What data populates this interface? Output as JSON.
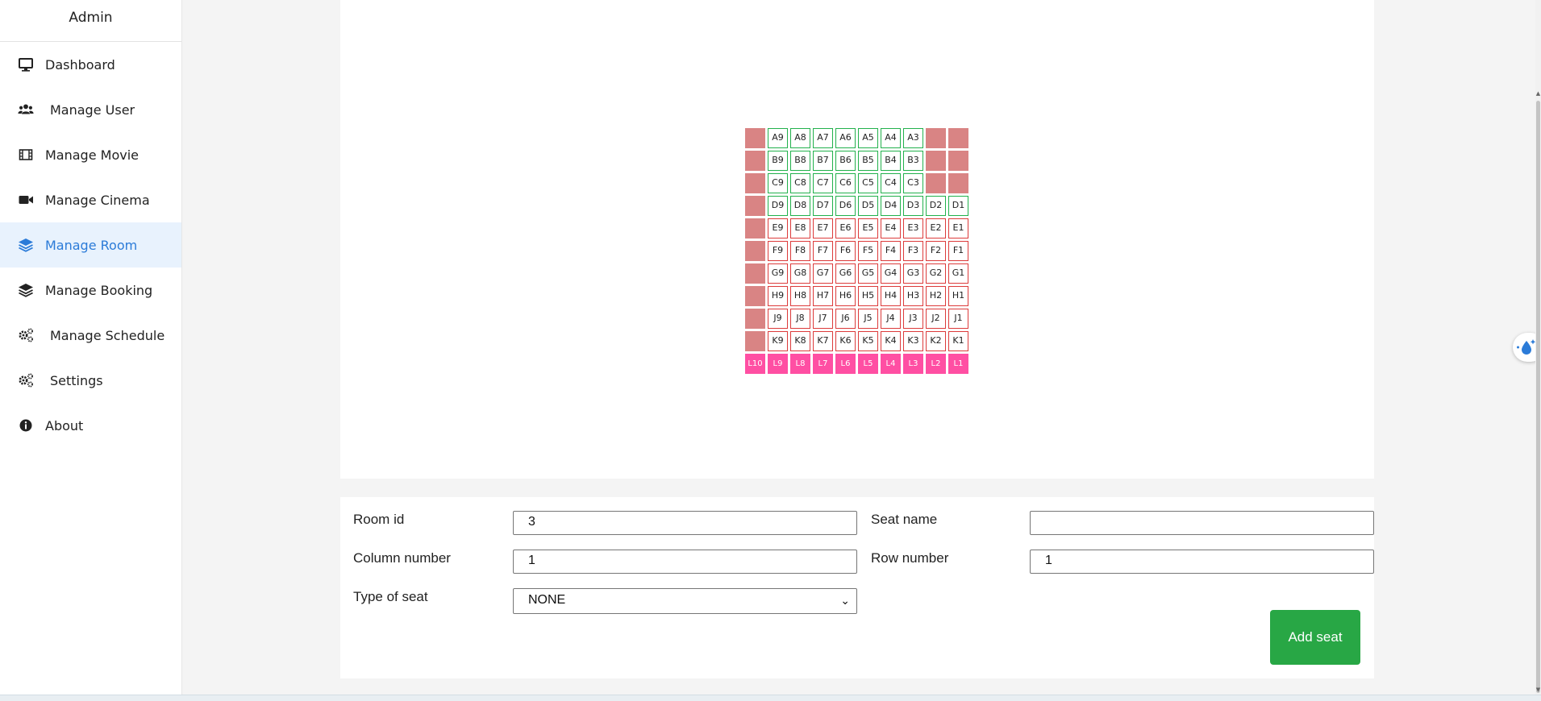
{
  "sidebar": {
    "brand": "Admin",
    "items": [
      {
        "label": "Dashboard",
        "icon": "desktop-icon"
      },
      {
        "label": "Manage User",
        "icon": "users-icon"
      },
      {
        "label": "Manage Movie",
        "icon": "film-icon"
      },
      {
        "label": "Manage Cinema",
        "icon": "video-camera-icon"
      },
      {
        "label": "Manage Room",
        "icon": "layers-icon",
        "active": true
      },
      {
        "label": "Manage Booking",
        "icon": "layers-icon"
      },
      {
        "label": "Manage Schedule",
        "icon": "gears-icon"
      },
      {
        "label": "Settings",
        "icon": "gears-icon"
      },
      {
        "label": "About",
        "icon": "info-circle-icon"
      }
    ]
  },
  "seat_map": {
    "rows": [
      [
        "",
        "A9",
        "A8",
        "A7",
        "A6",
        "A5",
        "A4",
        "A3",
        "",
        ""
      ],
      [
        "",
        "B9",
        "B8",
        "B7",
        "B6",
        "B5",
        "B4",
        "B3",
        "",
        ""
      ],
      [
        "",
        "C9",
        "C8",
        "C7",
        "C6",
        "C5",
        "C4",
        "C3",
        "",
        ""
      ],
      [
        "",
        "D9",
        "D8",
        "D7",
        "D6",
        "D5",
        "D4",
        "D3",
        "D2",
        "D1"
      ],
      [
        "",
        "E9",
        "E8",
        "E7",
        "E6",
        "E5",
        "E4",
        "E3",
        "E2",
        "E1"
      ],
      [
        "",
        "F9",
        "F8",
        "F7",
        "F6",
        "F5",
        "F4",
        "F3",
        "F2",
        "F1"
      ],
      [
        "",
        "G9",
        "G8",
        "G7",
        "G6",
        "G5",
        "G4",
        "G3",
        "G2",
        "G1"
      ],
      [
        "",
        "H9",
        "H8",
        "H7",
        "H6",
        "H5",
        "H4",
        "H3",
        "H2",
        "H1"
      ],
      [
        "",
        "J9",
        "J8",
        "J7",
        "J6",
        "J5",
        "J4",
        "J3",
        "J2",
        "J1"
      ],
      [
        "",
        "K9",
        "K8",
        "K7",
        "K6",
        "K5",
        "K4",
        "K3",
        "K2",
        "K1"
      ],
      [
        "L10",
        "L9",
        "L8",
        "L7",
        "L6",
        "L5",
        "L4",
        "L3",
        "L2",
        "L1"
      ]
    ],
    "types": [
      [
        "blocked",
        "vip",
        "vip",
        "vip",
        "vip",
        "vip",
        "vip",
        "vip",
        "blocked",
        "blocked"
      ],
      [
        "blocked",
        "vip",
        "vip",
        "vip",
        "vip",
        "vip",
        "vip",
        "vip",
        "blocked",
        "blocked"
      ],
      [
        "blocked",
        "vip",
        "vip",
        "vip",
        "vip",
        "vip",
        "vip",
        "vip",
        "blocked",
        "blocked"
      ],
      [
        "blocked",
        "vip",
        "vip",
        "vip",
        "vip",
        "vip",
        "vip",
        "vip",
        "vip",
        "vip"
      ],
      [
        "blocked",
        "normal",
        "normal",
        "normal",
        "normal",
        "normal",
        "normal",
        "normal",
        "normal",
        "normal"
      ],
      [
        "blocked",
        "normal",
        "normal",
        "normal",
        "normal",
        "normal",
        "normal",
        "normal",
        "normal",
        "normal"
      ],
      [
        "blocked",
        "normal",
        "normal",
        "normal",
        "normal",
        "normal",
        "normal",
        "normal",
        "normal",
        "normal"
      ],
      [
        "blocked",
        "normal",
        "normal",
        "normal",
        "normal",
        "normal",
        "normal",
        "normal",
        "normal",
        "normal"
      ],
      [
        "blocked",
        "normal",
        "normal",
        "normal",
        "normal",
        "normal",
        "normal",
        "normal",
        "normal",
        "normal"
      ],
      [
        "blocked",
        "normal",
        "normal",
        "normal",
        "normal",
        "normal",
        "normal",
        "normal",
        "normal",
        "normal"
      ],
      [
        "couple",
        "couple",
        "couple",
        "couple",
        "couple",
        "couple",
        "couple",
        "couple",
        "couple",
        "couple"
      ]
    ],
    "colors": {
      "vip_border": "#22b14c",
      "normal_border": "#dc3b3b",
      "blocked_fill": "#d98484",
      "couple_fill": "#ff4fa3"
    }
  },
  "form": {
    "room_id_label": "Room id",
    "room_id_value": "3",
    "seat_name_label": "Seat name",
    "seat_name_value": "",
    "column_number_label": "Column number",
    "column_number_value": "1",
    "row_number_label": "Row number",
    "row_number_value": "1",
    "type_of_seat_label": "Type of seat",
    "type_of_seat_value": "NONE",
    "add_seat_label": "Add seat"
  },
  "colors": {
    "accent": "#2b7bd8",
    "active_bg": "#e8f2fd",
    "button_green": "#28a745"
  }
}
